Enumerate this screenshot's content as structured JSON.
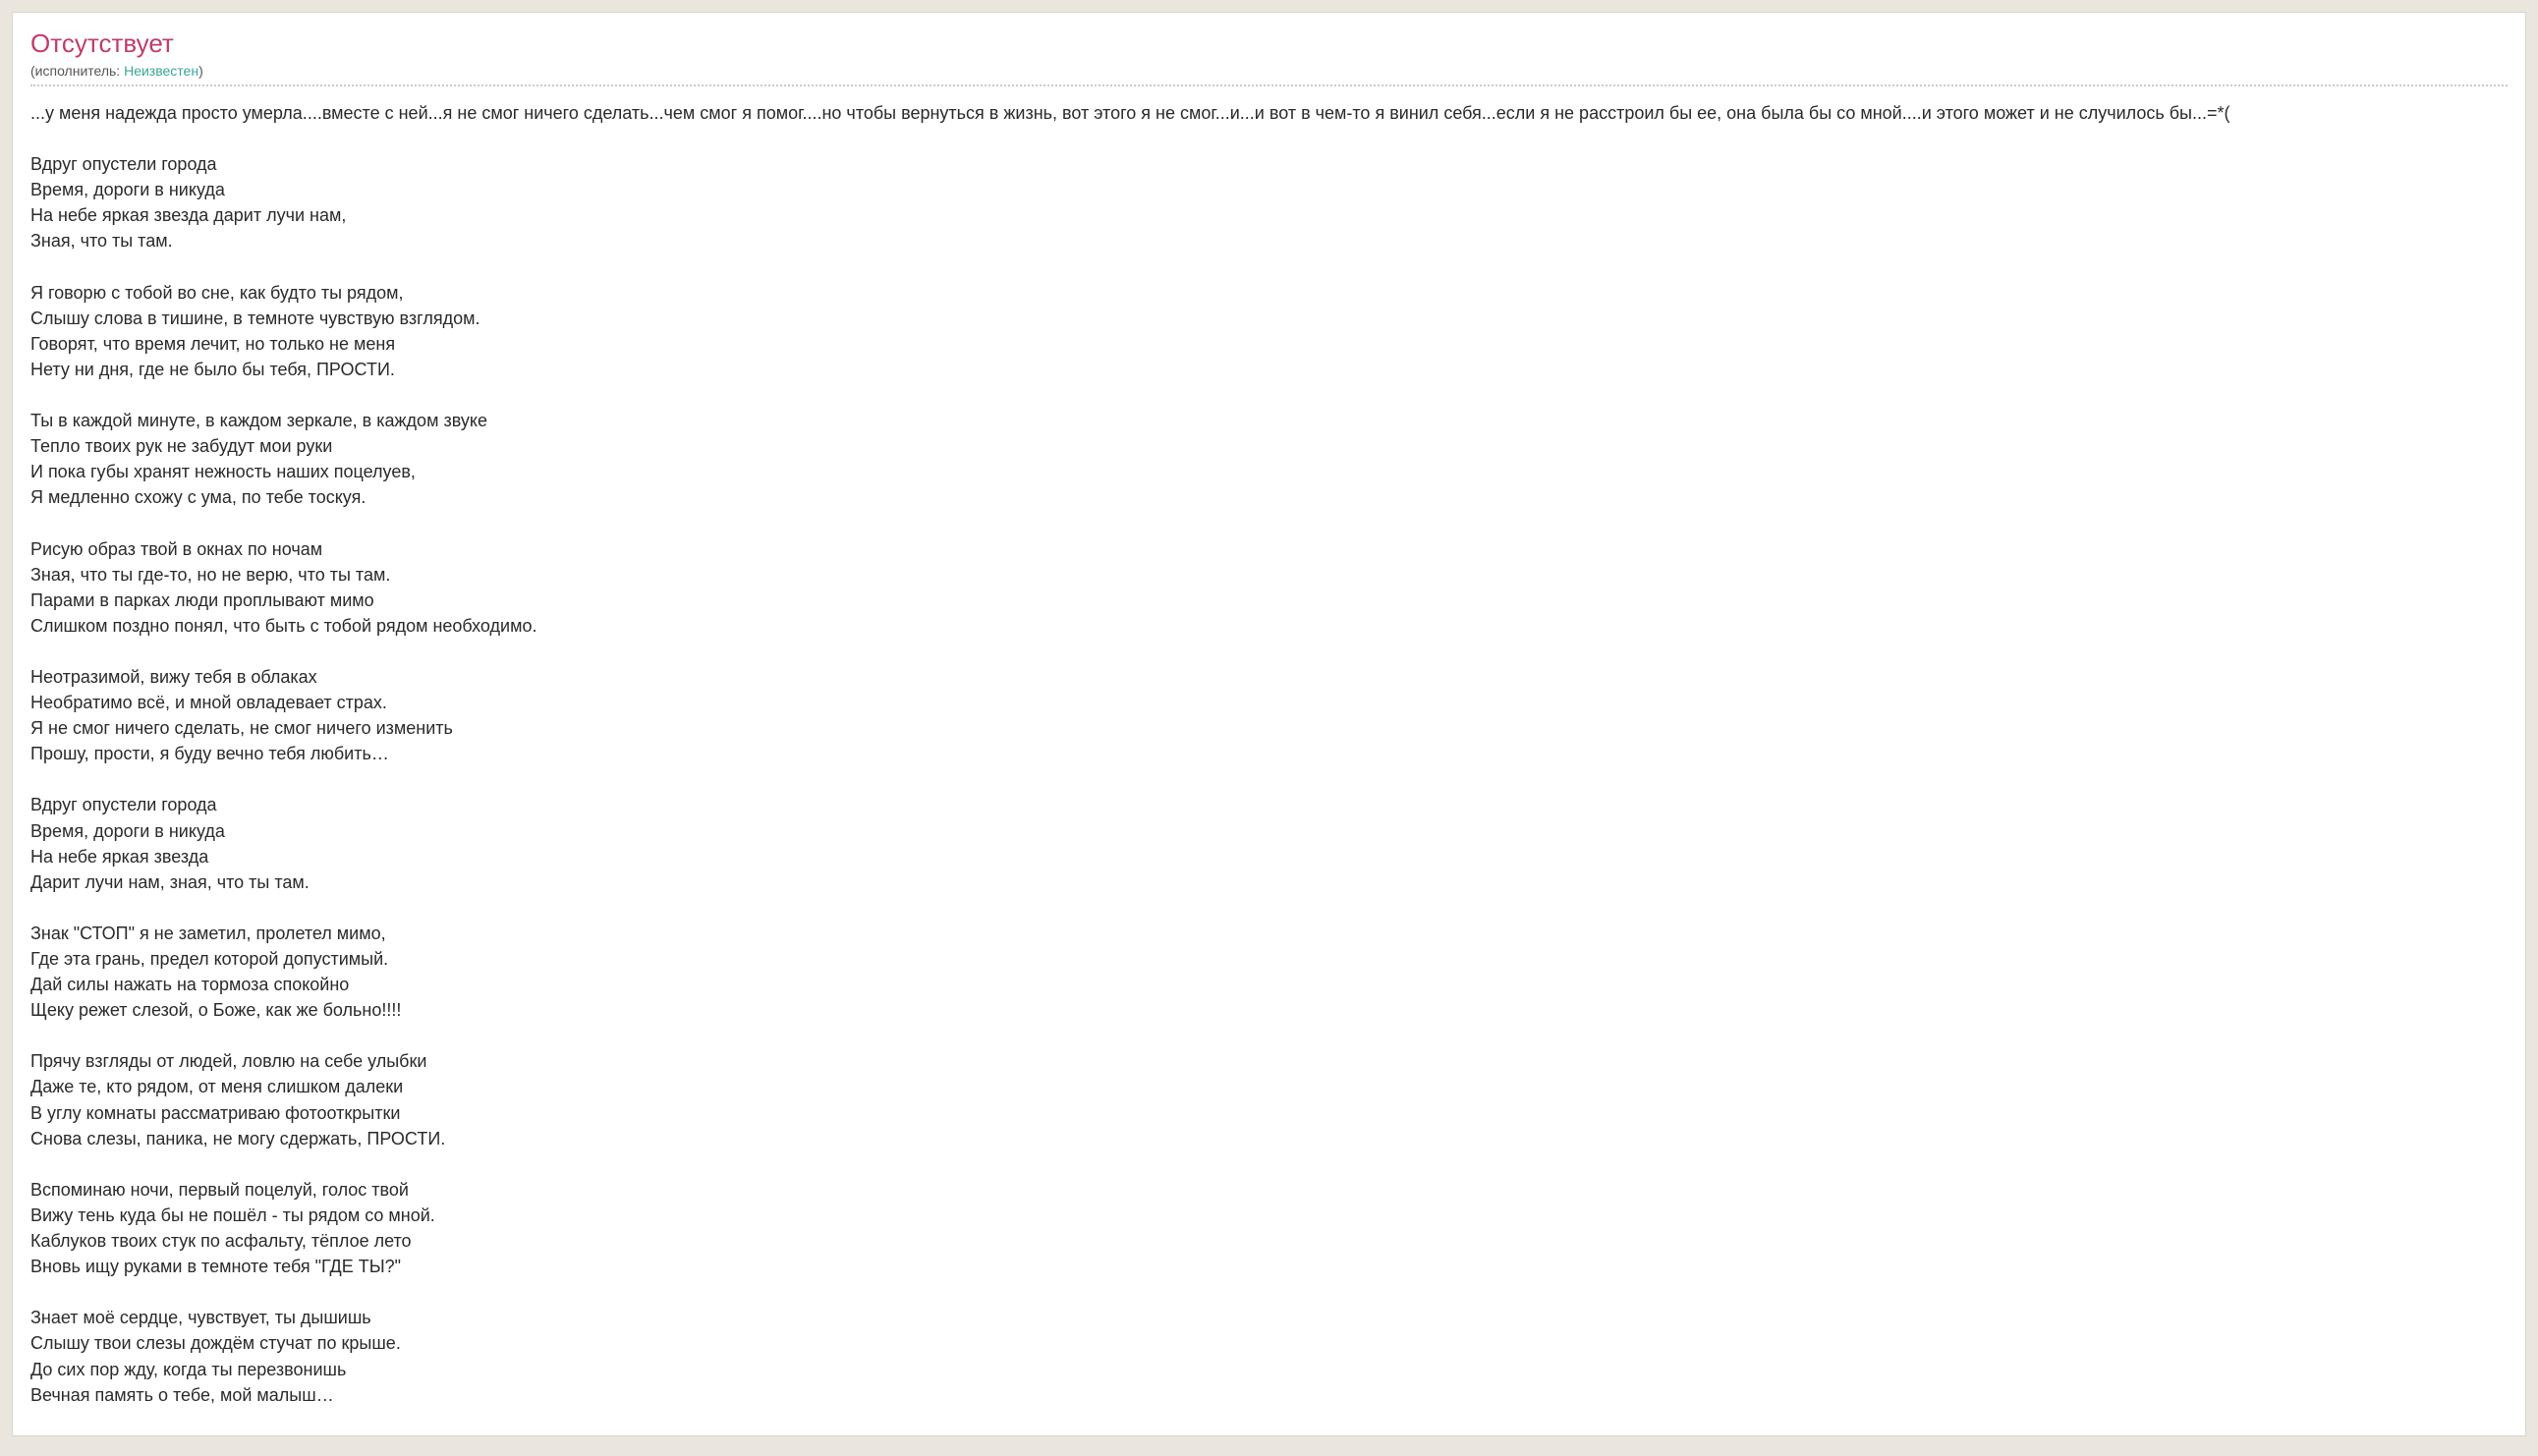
{
  "title": "Отсутствует",
  "byline": {
    "prefix": "(исполнитель: ",
    "artist": "Неизвестен",
    "suffix": ")"
  },
  "intro": "...у меня надежда просто умерла....вместе с ней...я не смог ничего сделать...чем смог я помог....но чтобы вернуться в жизнь, вот этого я не смог...и...и вот в чем-то я винил себя...если  я не расстроил бы ее, она была бы со мной....и этого может и не случилось бы...=*(",
  "lyrics": "Вдруг опустели города\nВремя, дороги в никуда\nНа небе яркая звезда дарит лучи нам,\nЗная, что ты там.\n\nЯ говорю с тобой во сне, как будто ты рядом,\nСлышу слова в тишине, в темноте чувствую взглядом.\nГоворят, что время лечит, но только не меня\nНету ни дня, где не было бы тебя, ПРОСТИ.\n\nТы в каждой минуте, в каждом зеркале, в каждом звуке\nТепло твоих рук не забудут мои руки\nИ пока губы хранят нежность наших поцелуев,\nЯ медленно схожу с ума, по тебе тоскуя.\n\nРисую образ твой в окнах по ночам\nЗная, что ты где-то, но не верю, что ты там.\nПарами в парках люди проплывают мимо\nСлишком поздно понял, что быть с тобой рядом необходимо.\n\nНеотразимой, вижу тебя в облаках\nНеобратимо всё, и мной овладевает страх.\nЯ не смог ничего сделать, не смог ничего изменить\nПрошу, прости, я буду вечно тебя любить…\n\nВдруг опустели города\nВремя, дороги в никуда\nНа небе яркая звезда\nДарит лучи нам, зная, что ты там.\n\nЗнак \"СТОП\" я не заметил, пролетел мимо,\nГде эта грань, предел которой допустимый.\nДай силы нажать на тормоза спокойно\nЩеку режет слезой, о Боже, как же больно!!!!\n\nПрячу взгляды от людей, ловлю на себе улыбки\nДаже те, кто рядом, от меня слишком далеки\nВ углу комнаты рассматриваю фотооткрытки\nСнова слезы, паника, не могу сдержать, ПРОСТИ.\n\nВспоминаю ночи, первый поцелуй, голос твой\nВижу тень куда бы не пошёл - ты рядом со мной.\nКаблуков твоих стук по асфальту, тёплое лето\nВновь ищу руками в темноте тебя \"ГДЕ ТЫ?\"\n\nЗнает моё сердце, чувствует, ты дышишь\nСлышу твои слезы дождём стучат по крыше.\nДо сих пор жду, когда ты перезвонишь\nВечная память о тебе, мой малыш…"
}
